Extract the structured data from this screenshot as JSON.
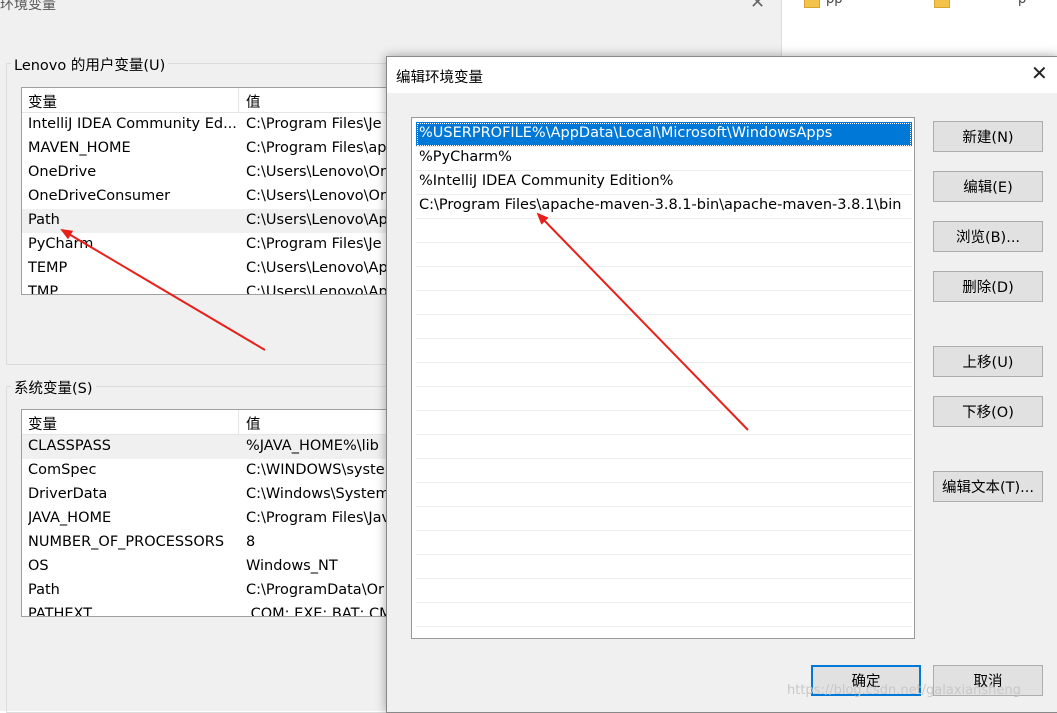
{
  "bg_window": {
    "title": "环境变量",
    "close_glyph": "✕",
    "user_group_label": "Lenovo 的用户变量(U)",
    "system_group_label": "系统变量(S)",
    "col_variable": "变量",
    "col_value": "值",
    "user_vars": [
      {
        "name": "IntelliJ IDEA Community Ed...",
        "value": "C:\\Program Files\\Je"
      },
      {
        "name": "MAVEN_HOME",
        "value": "C:\\Program Files\\ap"
      },
      {
        "name": "OneDrive",
        "value": "C:\\Users\\Lenovo\\Or"
      },
      {
        "name": "OneDriveConsumer",
        "value": "C:\\Users\\Lenovo\\Or"
      },
      {
        "name": "Path",
        "value": "C:\\Users\\Lenovo\\Ap"
      },
      {
        "name": "PyCharm",
        "value": "C:\\Program Files\\Je"
      },
      {
        "name": "TEMP",
        "value": "C:\\Users\\Lenovo\\Ap"
      },
      {
        "name": "TMP",
        "value": "C:\\Users\\Lenovo\\Ap"
      }
    ],
    "system_vars": [
      {
        "name": "CLASSPASS",
        "value": "%JAVA_HOME%\\lib"
      },
      {
        "name": "ComSpec",
        "value": "C:\\WINDOWS\\syste"
      },
      {
        "name": "DriverData",
        "value": "C:\\Windows\\System"
      },
      {
        "name": "JAVA_HOME",
        "value": "C:\\Program Files\\Jav"
      },
      {
        "name": "NUMBER_OF_PROCESSORS",
        "value": "8"
      },
      {
        "name": "OS",
        "value": "Windows_NT"
      },
      {
        "name": "Path",
        "value": "C:\\ProgramData\\Or"
      },
      {
        "name": "PATHEXT",
        "value": ".COM;.EXE;.BAT;.CM"
      }
    ]
  },
  "right_strip": {
    "items": [
      "pp",
      "p"
    ]
  },
  "edit_dialog": {
    "title": "编辑环境变量",
    "close_glyph": "✕",
    "paths": [
      "%USERPROFILE%\\AppData\\Local\\Microsoft\\WindowsApps",
      "%PyCharm%",
      "%IntelliJ IDEA Community Edition%",
      "C:\\Program Files\\apache-maven-3.8.1-bin\\apache-maven-3.8.1\\bin"
    ],
    "selected_index": 0,
    "buttons": {
      "new": "新建(N)",
      "edit": "编辑(E)",
      "browse": "浏览(B)...",
      "delete": "删除(D)",
      "move_up": "上移(U)",
      "move_down": "下移(O)",
      "edit_text": "编辑文本(T)...",
      "ok": "确定",
      "cancel": "取消"
    },
    "watermark": "https://blog.csdn.net/galaxiansheng"
  },
  "colors": {
    "selection": "#0078d7",
    "annotation_arrow": "#e8201a"
  }
}
